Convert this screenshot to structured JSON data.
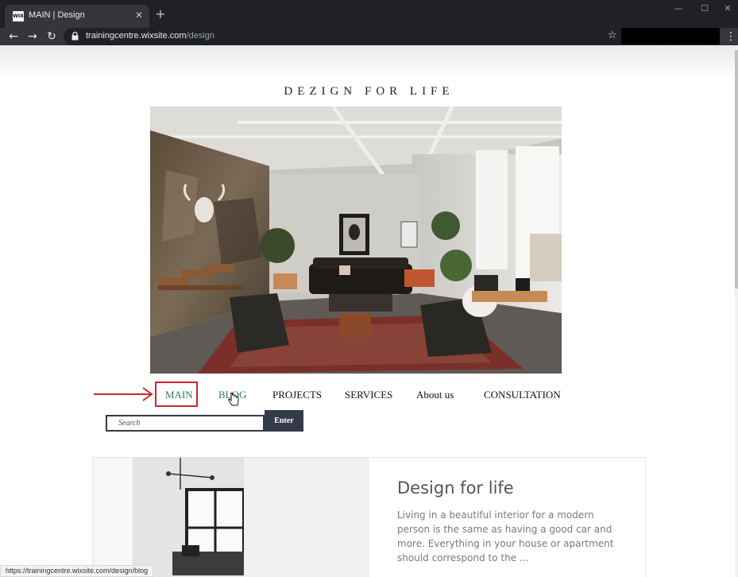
{
  "browser": {
    "tab_title": "MAIN | Design",
    "favicon_text": "WIX",
    "url_host": "trainingcentre.wixsite.com",
    "url_path": "/design",
    "status_url": "https://trainingcentre.wixsite.com/design/blog"
  },
  "site": {
    "title": "DEZIGN FOR LIFE",
    "nav": [
      {
        "label": "MAIN"
      },
      {
        "label": "BLOG"
      },
      {
        "label": "PROJECTS"
      },
      {
        "label": "SERVICES"
      },
      {
        "label": "About us"
      },
      {
        "label": "CONSULTATION"
      }
    ],
    "search": {
      "placeholder": "Search",
      "button": "Enter"
    },
    "card": {
      "title": "Design for life",
      "body": "Living in a beautiful interior for a modern person is the same as having a good car and more. Everything in your house or apartment should correspond to the ..."
    }
  },
  "colors": {
    "nav_active": "#2a7a69",
    "annotation": "#d3222a",
    "button": "#343a48"
  }
}
